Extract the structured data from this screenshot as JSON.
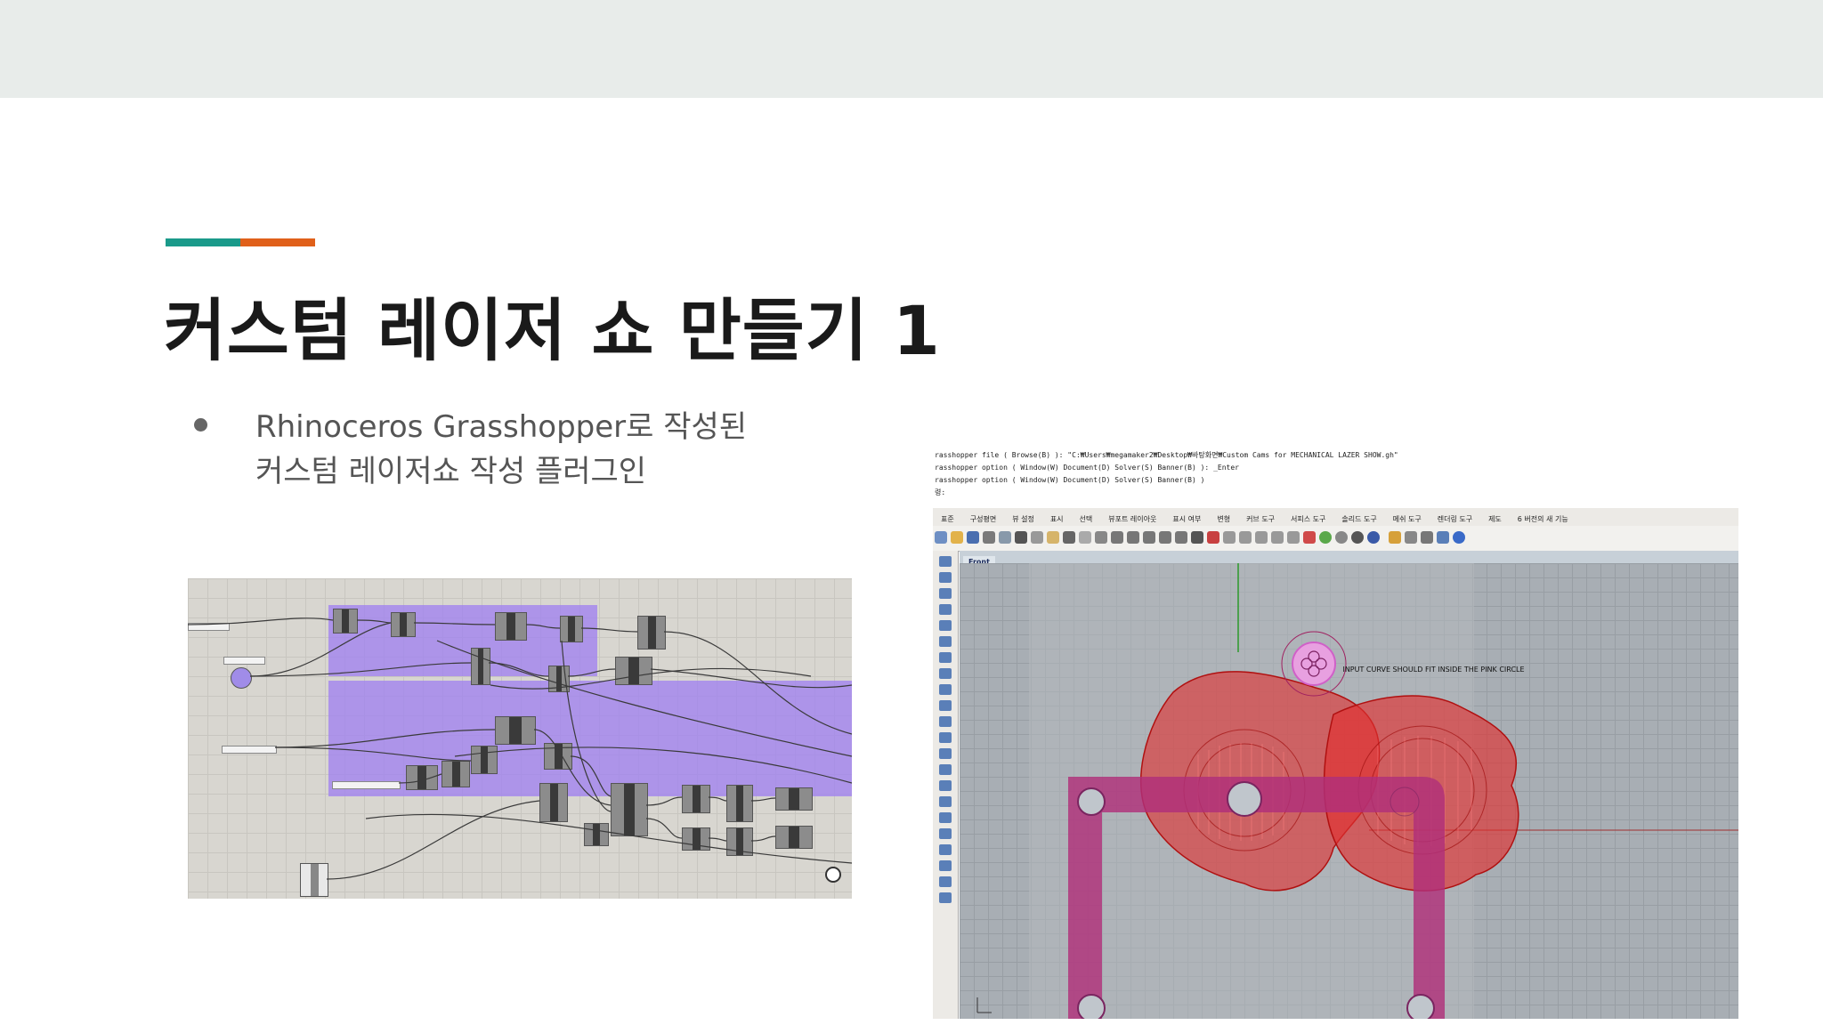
{
  "slide": {
    "title": "커스텀 레이저 쇼 만들기 1",
    "bullet_line1": "Rhinoceros Grasshopper로 작성된",
    "bullet_line2": "커스텀 레이저쇼 작성 플러그인",
    "accent_colors": [
      "#1a9a8a",
      "#e0601a"
    ]
  },
  "rhino": {
    "command_lines": [
      "rasshopper file ( Browse(B) ): \"C:₩Users₩megamaker2₩Desktop₩바탕화면₩Custom Cams for MECHANICAL LAZER SHOW.gh\"",
      "rasshopper option ( Window(W)  Document(D)  Solver(S)  Banner(B) ): _Enter",
      "rasshopper option ( Window(W)  Document(D)  Solver(S)  Banner(B) )",
      "령:"
    ],
    "menu_tabs": [
      "표준",
      "구성평면",
      "뷰 설정",
      "표시",
      "선택",
      "뷰포트 레이아웃",
      "표시 여부",
      "변형",
      "커브 도구",
      "서피스 도구",
      "솔리드 도구",
      "메쉬 도구",
      "렌더링 도구",
      "제도",
      "6 버전의 새 기능"
    ],
    "viewport_label": "Front",
    "viewport_note": "INPUT CURVE SHOULD FIT INSIDE THE PINK CIRCLE"
  }
}
